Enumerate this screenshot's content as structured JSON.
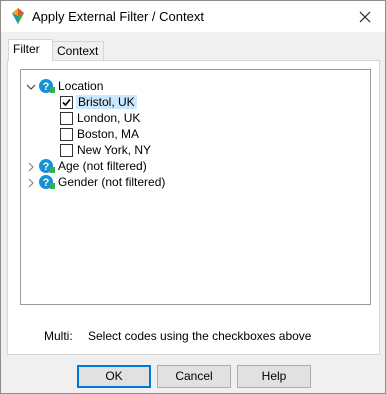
{
  "window": {
    "title": "Apply External Filter / Context"
  },
  "tabs": [
    {
      "label": "Filter",
      "active": true
    },
    {
      "label": "Context",
      "active": false
    }
  ],
  "tree": [
    {
      "label": "Location",
      "expanded": true,
      "icon": "question-icon",
      "children": [
        {
          "label": "Bristol, UK",
          "checked": true,
          "selected": true
        },
        {
          "label": "London, UK",
          "checked": false
        },
        {
          "label": "Boston, MA",
          "checked": false
        },
        {
          "label": "New York, NY",
          "checked": false
        }
      ]
    },
    {
      "label": "Age (not filtered)",
      "expanded": false,
      "icon": "question-icon"
    },
    {
      "label": "Gender (not filtered)",
      "expanded": false,
      "icon": "question-icon"
    }
  ],
  "status": {
    "mode": "Multi:",
    "hint": "Select codes using the checkboxes above"
  },
  "buttons": {
    "ok": "OK",
    "cancel": "Cancel",
    "help": "Help"
  },
  "colors": {
    "accent": "#0078d7",
    "selection": "#cce8ff",
    "icon_blue": "#1b8fd6"
  }
}
